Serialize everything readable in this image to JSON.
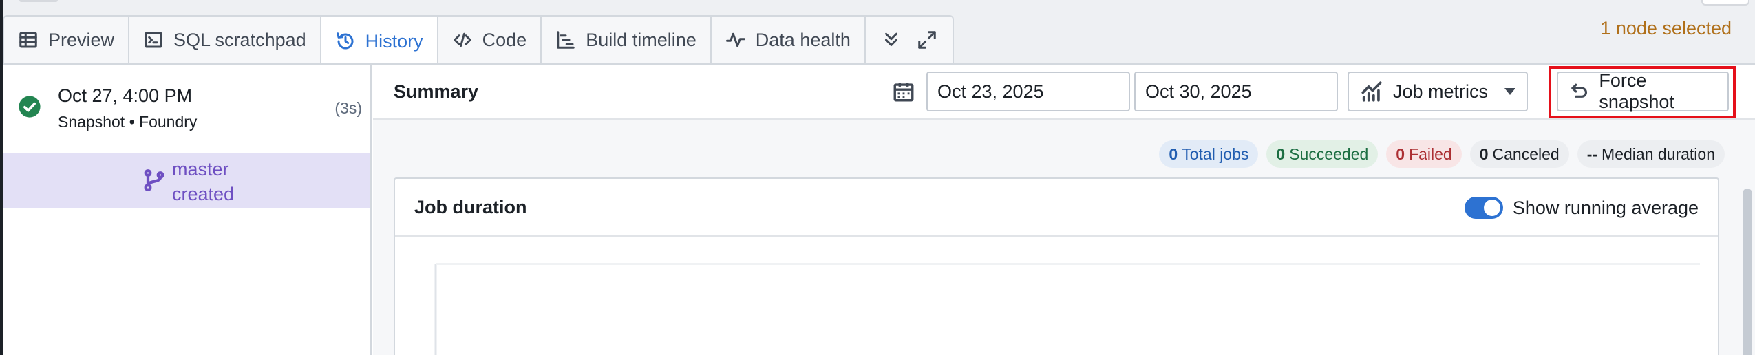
{
  "tabs": [
    {
      "label": "Preview",
      "icon": "table-icon"
    },
    {
      "label": "SQL scratchpad",
      "icon": "console-icon"
    },
    {
      "label": "History",
      "icon": "history-icon",
      "active": true
    },
    {
      "label": "Code",
      "icon": "code-icon"
    },
    {
      "label": "Build timeline",
      "icon": "gantt-icon"
    },
    {
      "label": "Data health",
      "icon": "pulse-icon"
    }
  ],
  "header": {
    "node_selected": "1 node selected"
  },
  "history": {
    "entry": {
      "date": "Oct 27, 4:00 PM",
      "subtitle": "Snapshot • Foundry",
      "duration": "(3s)",
      "status_icon": "success-check-icon"
    },
    "branch": {
      "line1": "master",
      "line2": "created",
      "icon": "git-branch-icon"
    }
  },
  "summary": {
    "title": "Summary",
    "date_start": "Oct 23, 2025",
    "date_end": "Oct 30, 2025",
    "metrics_label": "Job metrics",
    "force_snapshot_label": "Force snapshot"
  },
  "stats": {
    "total": {
      "count": "0",
      "label": "Total jobs"
    },
    "succeeded": {
      "count": "0",
      "label": "Succeeded"
    },
    "failed": {
      "count": "0",
      "label": "Failed"
    },
    "canceled": {
      "count": "0",
      "label": "Canceled"
    },
    "median": {
      "count": "--",
      "label": "Median duration"
    }
  },
  "job_duration": {
    "title": "Job duration",
    "toggle_label": "Show running average",
    "toggle_on": true
  },
  "colors": {
    "accent": "#2d72d2",
    "success": "#238551",
    "warning_text": "#b0701a",
    "highlight": "#e5101a",
    "branch": "#6e4fc2"
  }
}
